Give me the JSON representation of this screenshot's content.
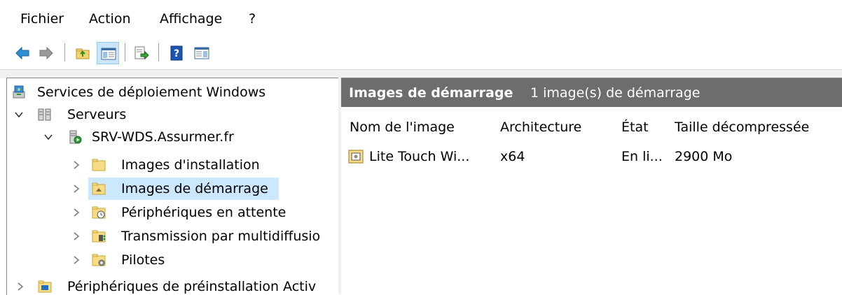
{
  "menu": {
    "items": [
      {
        "label": "Fichier"
      },
      {
        "label": "Action"
      },
      {
        "label": "Affichage"
      },
      {
        "label": "?"
      }
    ]
  },
  "toolbar": {
    "buttons": [
      {
        "icon": "back-arrow-icon"
      },
      {
        "icon": "forward-arrow-icon"
      },
      {
        "icon": "up-folder-icon"
      },
      {
        "icon": "show-hide-console-tree-icon",
        "pressed": true
      },
      {
        "icon": "export-list-icon"
      },
      {
        "icon": "help-icon"
      },
      {
        "icon": "show-hide-action-pane-icon"
      }
    ]
  },
  "tree": {
    "root": {
      "label": "Services de déploiement Windows",
      "icon": "wds-icon"
    },
    "servers": {
      "label": "Serveurs",
      "icon": "servers-icon",
      "expanded": true
    },
    "server": {
      "label": "SRV-WDS.Assurmer.fr",
      "icon": "server-icon",
      "expanded": true
    },
    "children": [
      {
        "label": "Images d'installation",
        "icon": "folder-icon"
      },
      {
        "label": "Images de démarrage",
        "icon": "boot-images-folder-icon",
        "selected": true
      },
      {
        "label": "Périphériques en attente",
        "icon": "pending-devices-icon"
      },
      {
        "label": "Transmission par multidiffusio",
        "icon": "multicast-icon"
      },
      {
        "label": "Pilotes",
        "icon": "drivers-icon"
      }
    ],
    "prestaged": {
      "label": "Périphériques de préinstallation Activ",
      "icon": "prestaged-devices-icon"
    }
  },
  "result": {
    "title": "Images de démarrage",
    "subtitle": "1 image(s) de démarrage",
    "columns": [
      "Nom de l'image",
      "Architecture",
      "État",
      "Taille décompressée"
    ],
    "rows": [
      {
        "name": "Lite Touch Wi...",
        "architecture": "x64",
        "state": "En li...",
        "size": "2900 Mo",
        "icon": "boot-image-icon"
      }
    ]
  },
  "colors": {
    "header_bg": "#6d6d6d",
    "selection_bg": "#cce8ff",
    "pressed_button_bg": "#cce4f7"
  }
}
